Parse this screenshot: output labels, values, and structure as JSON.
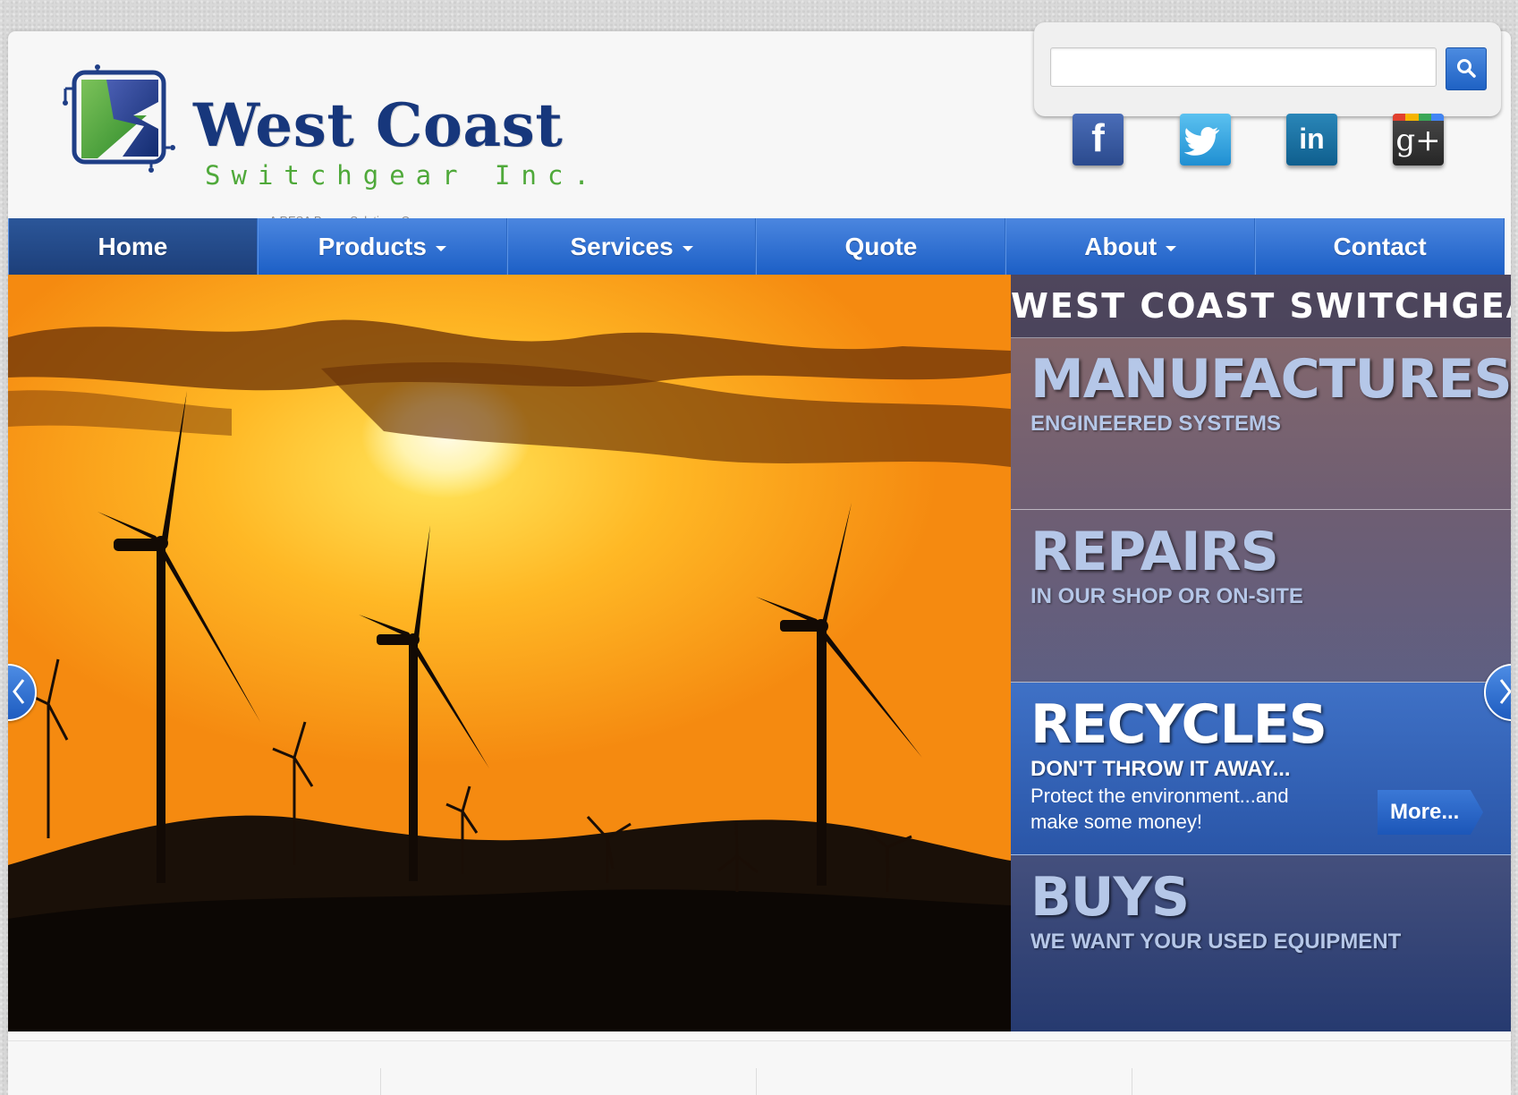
{
  "header": {
    "logo_name": "West Coast",
    "logo_sub": "Switchgear Inc.",
    "logo_tagline": "A RESA Power Solutions Company",
    "search": {
      "placeholder": "",
      "value": "",
      "button_icon": "search-icon"
    },
    "social": [
      {
        "name": "facebook-icon",
        "glyph": "f",
        "color": "#3b5998"
      },
      {
        "name": "twitter-icon",
        "glyph": "",
        "color": "#1da1f2"
      },
      {
        "name": "linkedin-icon",
        "glyph": "in",
        "color": "#0e76a8"
      },
      {
        "name": "google-plus-icon",
        "glyph": "g+",
        "color": "#333333"
      }
    ]
  },
  "nav": {
    "items": [
      {
        "label": "Home",
        "active": true,
        "dropdown": false
      },
      {
        "label": "Products",
        "active": false,
        "dropdown": true
      },
      {
        "label": "Services",
        "active": false,
        "dropdown": true
      },
      {
        "label": "Quote",
        "active": false,
        "dropdown": false
      },
      {
        "label": "About",
        "active": false,
        "dropdown": true
      },
      {
        "label": "Contact",
        "active": false,
        "dropdown": false
      }
    ]
  },
  "hero": {
    "side_title": "WEST COAST SWITCHGEAR",
    "panels": [
      {
        "heading": "MANUFACTURES",
        "sub": "ENGINEERED SYSTEMS"
      },
      {
        "heading": "REPAIRS",
        "sub": "IN OUR SHOP OR ON-SITE"
      },
      {
        "heading": "RECYCLES",
        "sub": "DON'T THROW IT AWAY...",
        "desc_line1": "Protect the environment...and",
        "desc_line2": "make some money!",
        "button": "More..."
      },
      {
        "heading": "BUYS",
        "sub": "WE WANT YOUR USED EQUIPMENT"
      }
    ],
    "active_panel": 2
  },
  "colors": {
    "nav_blue": "#2a6bd0",
    "brand_navy": "#17377c",
    "brand_green": "#4fa93a"
  }
}
